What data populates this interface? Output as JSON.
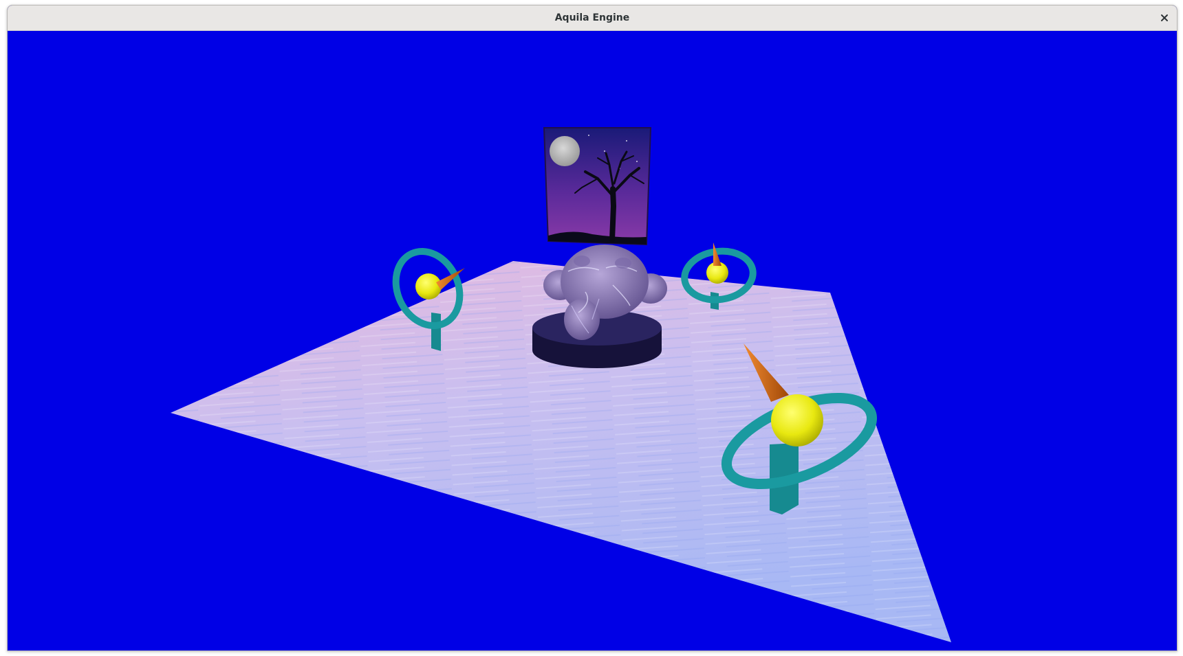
{
  "window": {
    "title": "Aquila Engine",
    "close_icon": "close-icon"
  },
  "scene": {
    "background_color": "#0000e6",
    "floor_colors": [
      "#b7c0f4",
      "#d7b9e6",
      "#a8b8f2"
    ],
    "ring_color": "#1a9aa0",
    "sphere_color": "#eaea10",
    "cone_color": "#e06a1a",
    "pedestal_color": "#1c1848",
    "painting_sky": [
      "#1a1a7a",
      "#8a3aa0"
    ],
    "objects": [
      "painting-moon-tree",
      "monkey-head-statue",
      "pedestal",
      "gyro-ornament-left",
      "gyro-ornament-center-right",
      "gyro-ornament-front"
    ]
  }
}
